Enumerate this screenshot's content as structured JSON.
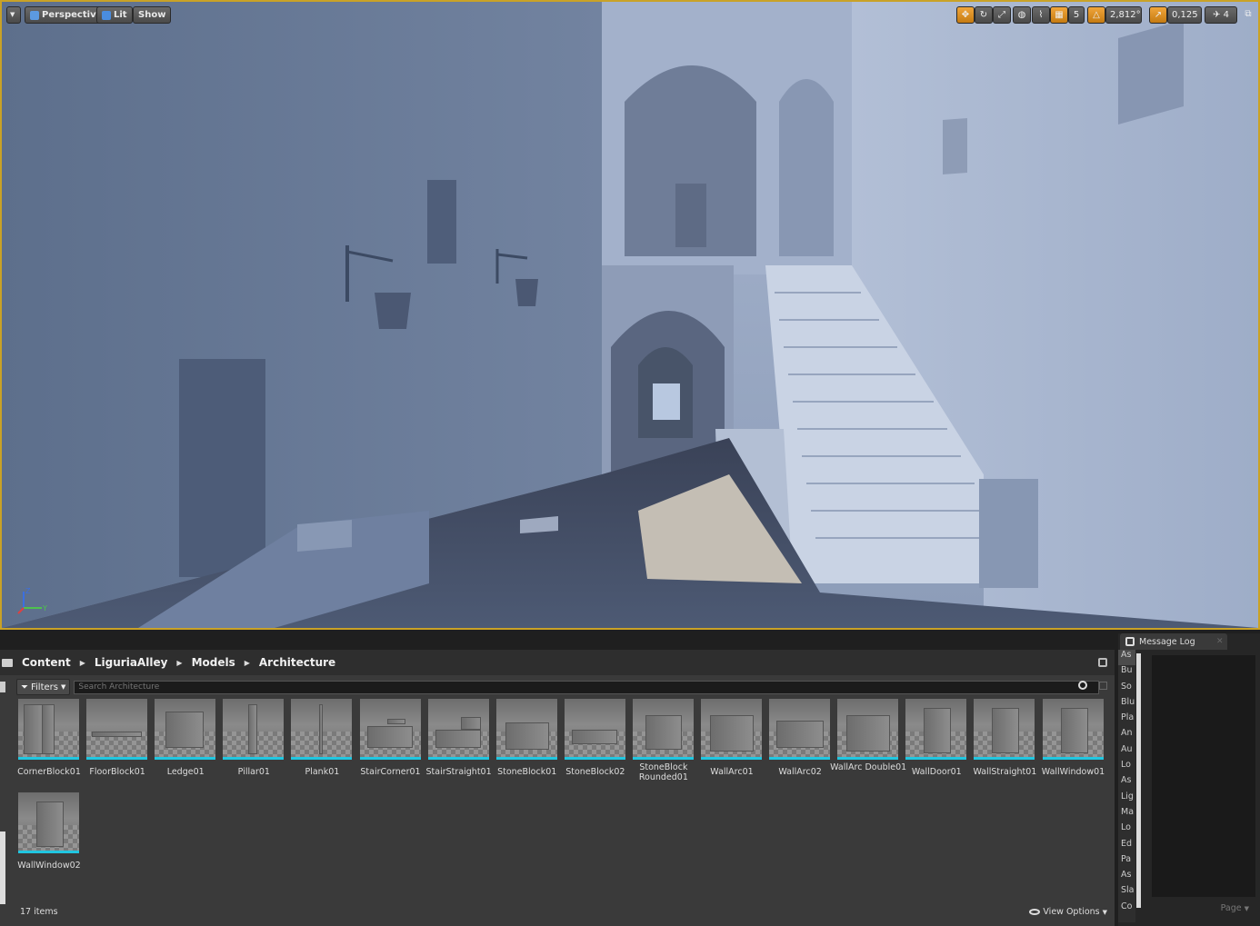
{
  "viewport": {
    "view_mode": "Perspective",
    "lighting": "Lit",
    "show_label": "Show",
    "grid_snap": "5",
    "rotation_snap": "2,812°",
    "scale_snap": "0,125",
    "camera_speed": "4",
    "accent_color": "#c9a227"
  },
  "path": {
    "crumbs": [
      "Content",
      "LiguriaAlley",
      "Models",
      "Architecture"
    ]
  },
  "filters": {
    "label": "Filters",
    "search_placeholder": "Search Architecture"
  },
  "assets": [
    {
      "label": "CornerBlock01"
    },
    {
      "label": "FloorBlock01"
    },
    {
      "label": "Ledge01"
    },
    {
      "label": "Pillar01"
    },
    {
      "label": "Plank01"
    },
    {
      "label": "StairCorner01"
    },
    {
      "label": "StairStraight01"
    },
    {
      "label": "StoneBlock01"
    },
    {
      "label": "StoneBlock02"
    },
    {
      "label": "StoneBlock Rounded01"
    },
    {
      "label": "WallArc01"
    },
    {
      "label": "WallArc02"
    },
    {
      "label": "WallArc Double01"
    },
    {
      "label": "WallDoor01"
    },
    {
      "label": "WallStraight01"
    },
    {
      "label": "WallWindow01"
    },
    {
      "label": "WallWindow02"
    }
  ],
  "status": {
    "item_count": "17 items",
    "view_options": "View Options"
  },
  "message_log": {
    "tab_label": "Message Log",
    "categories": [
      "As",
      "Bu",
      "So",
      "Blu",
      "Pla",
      "An",
      "Au",
      "Lo",
      "As",
      "Lig",
      "Ma",
      "Lo",
      "Ed",
      "Pa",
      "As",
      "Sla",
      "Co"
    ],
    "page_label": "Page"
  },
  "thumb_accent": "#21c6e0"
}
